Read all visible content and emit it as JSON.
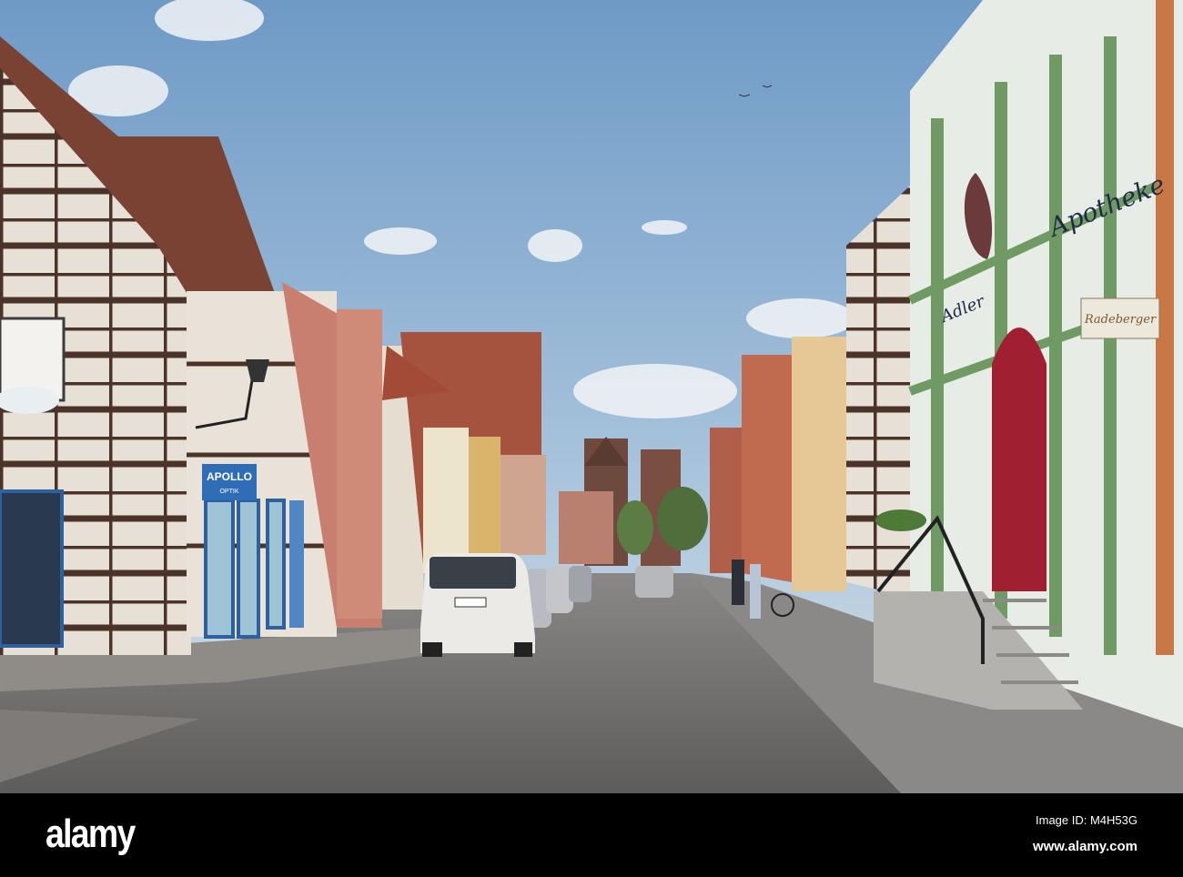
{
  "signs": {
    "apollo": "APOLLO",
    "apollo_sub": "OPTIK",
    "apotheke": "Apotheke",
    "adler": "Adler",
    "radeberger": "Radeberger"
  },
  "watermark": {
    "logo": "alamy",
    "image_id": "Image ID: M4H53G",
    "url": "www.alamy.com"
  },
  "colors": {
    "sky": "#7fa6cc",
    "timber": "#4a3328",
    "plaster": "#e8e2d8",
    "green_trim": "#6f9a64",
    "red_door": "#a01f30",
    "cobble": "#6e6c6a"
  }
}
